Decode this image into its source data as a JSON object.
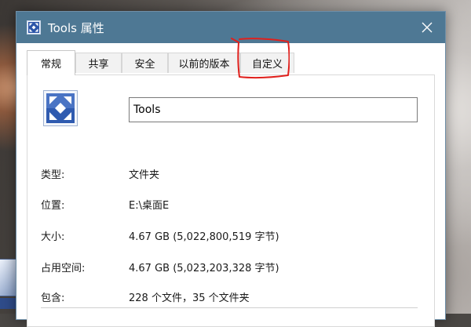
{
  "window": {
    "title": "Tools 属性",
    "close_symbol": "✕"
  },
  "tabs": [
    {
      "label": "常规",
      "active": true
    },
    {
      "label": "共享",
      "active": false
    },
    {
      "label": "安全",
      "active": false
    },
    {
      "label": "以前的版本",
      "active": false
    },
    {
      "label": "自定义",
      "active": false,
      "highlighted": true
    }
  ],
  "general": {
    "folder_name": "Tools",
    "rows": [
      {
        "label": "类型:",
        "value": "文件夹"
      },
      {
        "label": "位置:",
        "value": "E:\\桌面E"
      },
      {
        "label": "大小:",
        "value": "4.67 GB (5,022,800,519 字节)"
      },
      {
        "label": "占用空间:",
        "value": "4.67 GB (5,023,203,328 字节)"
      },
      {
        "label": "包含:",
        "value": "228 个文件，35 个文件夹"
      }
    ]
  },
  "icons": {
    "title_icon": "folder-customize-icon",
    "big_icon": "folder-customize-icon",
    "close": "close-icon"
  },
  "colors": {
    "titlebar": "#4e7894",
    "annotation": "#e0201c"
  }
}
